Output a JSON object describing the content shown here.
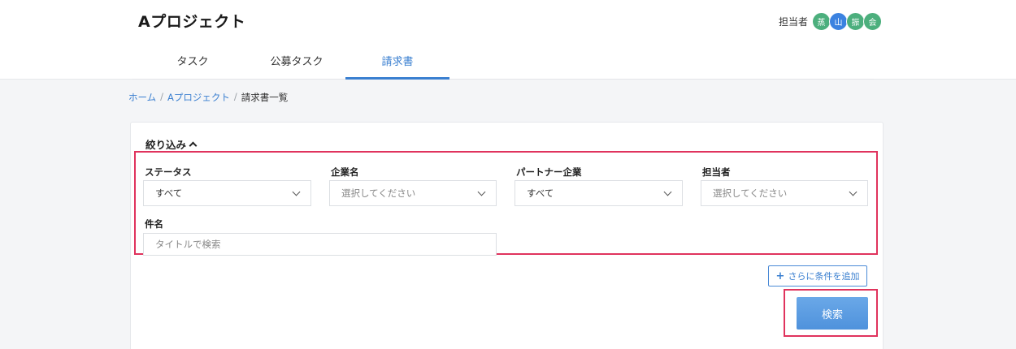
{
  "header": {
    "project_title": "Aプロジェクト",
    "assignee_label": "担当者",
    "avatars": [
      {
        "text": "蒸",
        "color": "#4caf7d"
      },
      {
        "text": "山",
        "color": "#3b82e0"
      },
      {
        "text": "振",
        "color": "#4caf7d"
      },
      {
        "text": "会",
        "color": "#4caf7d"
      }
    ]
  },
  "tabs": [
    {
      "label": "タスク",
      "active": false
    },
    {
      "label": "公募タスク",
      "active": false
    },
    {
      "label": "請求書",
      "active": true
    }
  ],
  "breadcrumb": {
    "home": "ホーム",
    "project": "Aプロジェクト",
    "current": "請求書一覧",
    "separator": "/"
  },
  "filter": {
    "toggle_label": "絞り込み",
    "status": {
      "label": "ステータス",
      "value": "すべて"
    },
    "company": {
      "label": "企業名",
      "placeholder": "選択してください"
    },
    "partner": {
      "label": "パートナー企業",
      "value": "すべて"
    },
    "assignee": {
      "label": "担当者",
      "placeholder": "選択してください"
    },
    "subject": {
      "label": "件名",
      "placeholder": "タイトルで検索"
    },
    "add_condition": "さらに条件を追加",
    "search_button": "検索"
  },
  "colors": {
    "accent": "#3a7fd0",
    "highlight": "#e0335d",
    "search_button": "#5b9be0"
  }
}
